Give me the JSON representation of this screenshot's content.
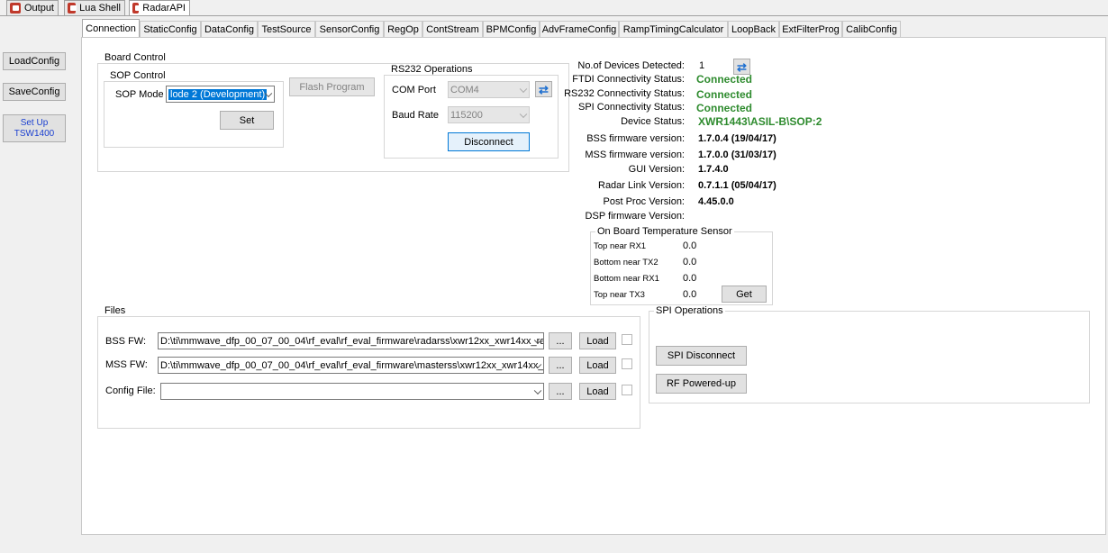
{
  "doc_tabs": [
    "Output",
    "Lua Shell",
    "RadarAPI"
  ],
  "side_buttons": {
    "load": "LoadConfig",
    "save": "SaveConfig",
    "setup_line1": "Set Up",
    "setup_line2": "TSW1400"
  },
  "tabs": [
    "Connection",
    "StaticConfig",
    "DataConfig",
    "TestSource",
    "SensorConfig",
    "RegOp",
    "ContStream",
    "BPMConfig",
    "AdvFrameConfig",
    "RampTimingCalculator",
    "LoopBack",
    "ExtFilterProg",
    "CalibConfig"
  ],
  "board_control": {
    "title": "Board Control",
    "sop_title": "SOP Control",
    "sop_label": "SOP Mode",
    "sop_value": "lode 2 (Development)",
    "set_button": "Set",
    "flash_button": "Flash Program"
  },
  "rs232": {
    "title": "RS232 Operations",
    "com_label": "COM Port",
    "com_value": "COM4",
    "baud_label": "Baud Rate",
    "baud_value": "115200",
    "disconnect_button": "Disconnect"
  },
  "status": {
    "devices_label": "No.of Devices Detected:",
    "devices_value": "1",
    "ftdi_label": "FTDI Connectivity Status:",
    "ftdi_value": "Connected",
    "rs232_label": "RS232 Connectivity Status:",
    "rs232_value": "Connected",
    "spi_label": "SPI Connectivity Status:",
    "spi_value": "Connected",
    "device_label": "Device Status:",
    "device_value": "XWR1443\\ASIL-B\\SOP:2",
    "bss_label": "BSS firmware version:",
    "bss_value": "1.7.0.4 (19/04/17)",
    "mss_label": "MSS firmware version:",
    "mss_value": "1.7.0.0 (31/03/17)",
    "gui_label": "GUI Version:",
    "gui_value": "1.7.4.0",
    "radarlink_label": "Radar Link Version:",
    "radarlink_value": "0.7.1.1 (05/04/17)",
    "postproc_label": "Post Proc Version:",
    "postproc_value": "4.45.0.0",
    "dsp_label": "DSP firmware Version:"
  },
  "temperature": {
    "title": "On Board Temperature Sensor",
    "rows": [
      {
        "label": "Top near RX1",
        "value": "0.0"
      },
      {
        "label": "Bottom near TX2",
        "value": "0.0"
      },
      {
        "label": "Bottom near RX1",
        "value": "0.0"
      },
      {
        "label": "Top near TX3",
        "value": "0.0"
      }
    ],
    "get_button": "Get"
  },
  "files": {
    "title": "Files",
    "bss_label": "BSS FW:",
    "bss_path": "D:\\ti\\mmwave_dfp_00_07_00_04\\rf_eval\\rf_eval_firmware\\radarss\\xwr12xx_xwr14xx_ra",
    "mss_label": "MSS FW:",
    "mss_path": "D:\\ti\\mmwave_dfp_00_07_00_04\\rf_eval\\rf_eval_firmware\\masterss\\xwr12xx_xwr14xx_",
    "config_label": "Config File:",
    "config_path": "",
    "browse": "...",
    "load": "Load"
  },
  "spi": {
    "title": "SPI Operations",
    "disconnect_button": "SPI Disconnect",
    "rf_button": "RF Powered-up"
  }
}
